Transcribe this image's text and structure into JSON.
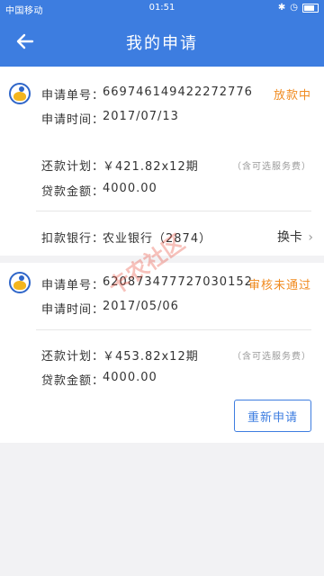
{
  "statusbar": {
    "carrier": "中国移动",
    "time": "01:51"
  },
  "header": {
    "title": "我的申请"
  },
  "applications": [
    {
      "app_no_label": "申请单号：",
      "app_no": "669746149422272776",
      "status": "放款中",
      "time_label": "申请时间：",
      "time": "2017/07/13",
      "plan_label": "还款计划：",
      "plan": "￥421.82x12期",
      "plan_note": "（含可选服务费）",
      "amount_label": "贷款金额：",
      "amount": "4000.00",
      "bank_label": "扣款银行：",
      "bank": "农业银行（2874）",
      "change_card": "换卡"
    },
    {
      "app_no_label": "申请单号：",
      "app_no": "620873477727030152",
      "status": "审核未通过",
      "time_label": "申请时间：",
      "time": "2017/05/06",
      "plan_label": "还款计划：",
      "plan": "￥453.82x12期",
      "plan_note": "（含可选服务费）",
      "amount_label": "贷款金额：",
      "amount": "4000.00",
      "reapply": "重新申请"
    }
  ],
  "watermark": "卡农社区"
}
